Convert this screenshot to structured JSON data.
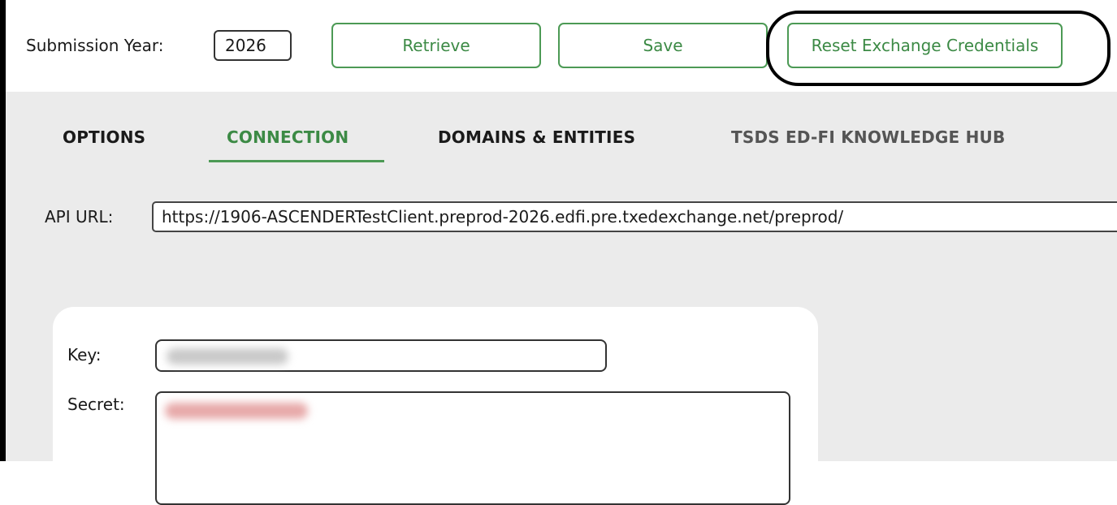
{
  "toolbar": {
    "submission_year_label": "Submission Year:",
    "submission_year_value": "2026",
    "retrieve_label": "Retrieve",
    "save_label": "Save",
    "reset_label": "Reset Exchange Credentials"
  },
  "tabs": [
    {
      "label": "OPTIONS",
      "active": false
    },
    {
      "label": "CONNECTION",
      "active": true
    },
    {
      "label": "DOMAINS & ENTITIES",
      "active": false
    },
    {
      "label": "TSDS ED-FI KNOWLEDGE HUB",
      "active": false
    }
  ],
  "connection": {
    "api_url_label": "API URL:",
    "api_url_value": "https://1906-ASCENDERTestClient.preprod-2026.edfi.pre.txedexchange.net/preprod/",
    "key_label": "Key:",
    "secret_label": "Secret:"
  },
  "colors": {
    "accent_green": "#4c9a55",
    "content_background": "#ebebeb",
    "highlight_ring": "#000000"
  }
}
